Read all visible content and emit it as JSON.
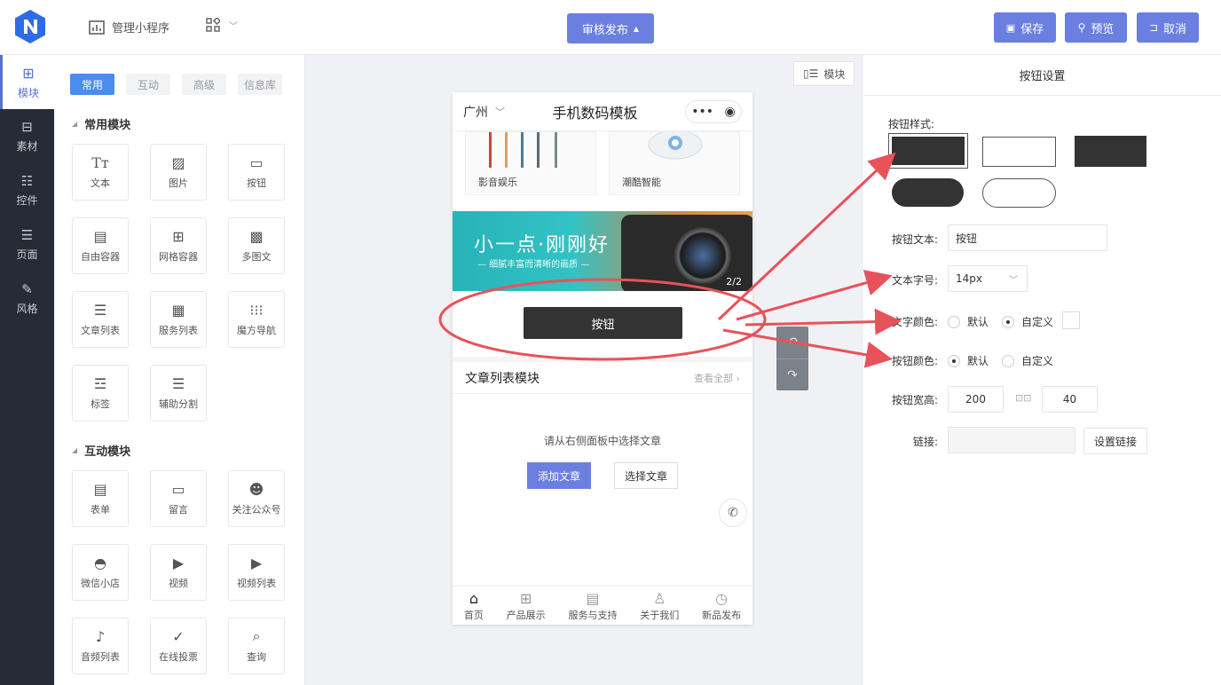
{
  "topbar": {
    "mini_program_label": "管理小程序",
    "publish_label": "审核发布",
    "save_label": "保存",
    "preview_label": "预览",
    "cancel_label": "取消"
  },
  "leftnav": {
    "items": [
      {
        "label": "模块"
      },
      {
        "label": "素材"
      },
      {
        "label": "控件"
      },
      {
        "label": "页面"
      },
      {
        "label": "风格"
      }
    ]
  },
  "palette": {
    "tabs": [
      "常用",
      "互动",
      "高级",
      "信息库"
    ],
    "section1_title": "常用模块",
    "section1_items": [
      "文本",
      "图片",
      "按钮",
      "自由容器",
      "网格容器",
      "多图文",
      "文章列表",
      "服务列表",
      "魔方导航",
      "标签",
      "辅助分割"
    ],
    "section2_title": "互动模块",
    "section2_items": [
      "表单",
      "留言",
      "关注公众号",
      "微信小店",
      "视频",
      "视频列表",
      "音频列表",
      "在线投票",
      "查询"
    ]
  },
  "canvas": {
    "module_toggle_label": "模块"
  },
  "phone": {
    "city": "广州",
    "title": "手机数码模板",
    "products": [
      "影音娱乐",
      "潮酷智能"
    ],
    "banner_title": "小一点·刚刚好",
    "banner_sub": "— 细腻丰富而清晰的画质 —",
    "banner_page": "2/2",
    "button_label": "按钮",
    "article_header": "文章列表模块",
    "article_more": "查看全部",
    "article_empty": "请从右侧面板中选择文章",
    "add_article": "添加文章",
    "select_article": "选择文章",
    "tabbar": [
      "首页",
      "产品展示",
      "服务与支持",
      "关于我们",
      "新品发布"
    ]
  },
  "settings": {
    "title": "按钮设置",
    "style_label": "按钮样式:",
    "text_label": "按钮文本:",
    "text_value": "按钮",
    "fontsize_label": "文本字号:",
    "fontsize_value": "14px",
    "textcolor_label": "文字颜色:",
    "btncolor_label": "按钮颜色:",
    "default_label": "默认",
    "custom_label": "自定义",
    "size_label": "按钮宽高:",
    "width_value": "200",
    "height_value": "40",
    "link_label": "链接:",
    "link_button": "设置链接"
  },
  "colors": {
    "accent": "#6a7fe0",
    "nav_bg": "#262b35",
    "annotation": "#e8525a"
  }
}
